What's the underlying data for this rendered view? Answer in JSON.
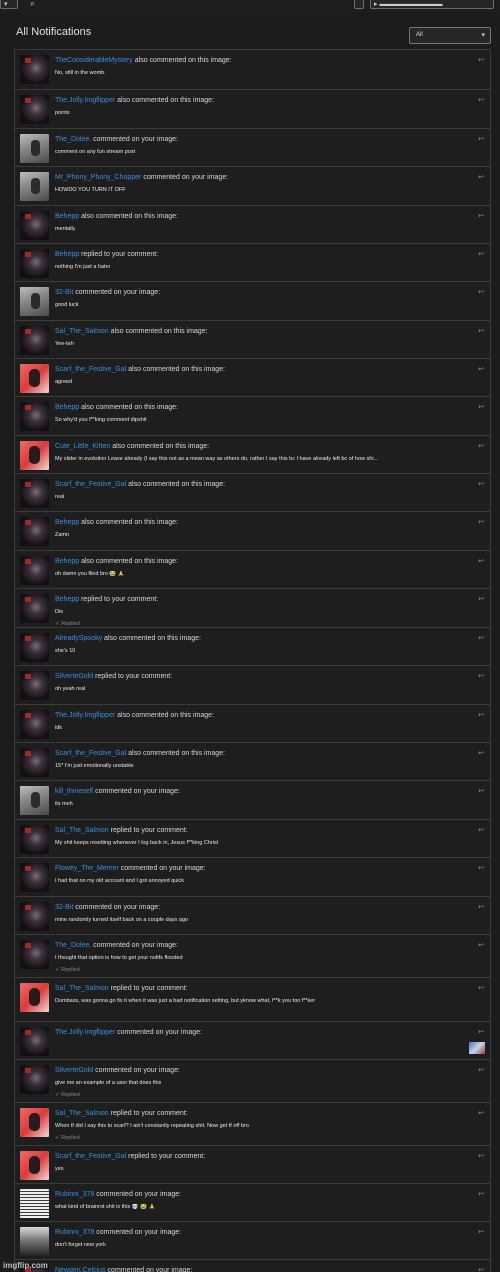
{
  "topbar": {
    "search_icon": "search-icon",
    "dropdown_icon": "chevron-down-icon"
  },
  "header": {
    "title": "All Notifications",
    "filter": {
      "selected": "All"
    }
  },
  "notifications": [
    {
      "user": "TheConsiderableMystery",
      "action": "also commented on this image:",
      "message": "No, still in the womb.",
      "avatar": "dark"
    },
    {
      "user": "The.Jolly.Imgflipper",
      "action": "also commented on this image:",
      "message": "points",
      "avatar": "dark"
    },
    {
      "user": "The_Dolee.",
      "action": "commented on your image:",
      "message": "comment on any fun stream post",
      "avatar": "gray"
    },
    {
      "user": "Mr_Phony_Phony_Chopper",
      "action": "commented on your image:",
      "message": "HOWDO YOU TURN IT OFF",
      "avatar": "gray"
    },
    {
      "user": "Behepp",
      "action": "also commented on this image:",
      "message": "mentally",
      "avatar": "dark"
    },
    {
      "user": "Behepp",
      "action": "replied to your comment:",
      "message": "nothing I'm just a hater",
      "avatar": "dark"
    },
    {
      "user": "32-Bit",
      "action": "commented on your image:",
      "message": "good luck",
      "avatar": "gray"
    },
    {
      "user": "Sal_The_Salmon",
      "action": "also commented on this image:",
      "message": "Yee-teh",
      "avatar": "dark"
    },
    {
      "user": "Scarf_the_Festive_Gal",
      "action": "also commented on this image:",
      "message": "agreed",
      "avatar": "red"
    },
    {
      "user": "Behepp",
      "action": "also commented on this image:",
      "message": "So why'd you f**king comment dipshit",
      "avatar": "dark"
    },
    {
      "user": "Cute_Little_Kitten",
      "action": "also commented on this image:",
      "message": "My slider in evolution Leave already (I say this not as a mean way as others do, rather I say this bc I have already left bc of how shi...",
      "avatar": "red"
    },
    {
      "user": "Scarf_the_Festive_Gal",
      "action": "also commented on this image:",
      "message": "real",
      "avatar": "dark"
    },
    {
      "user": "Behepp",
      "action": "also commented on this image:",
      "message": "Zamn",
      "avatar": "dark"
    },
    {
      "user": "Behepp",
      "action": "also commented on this image:",
      "message": "oh damn you filed bro 😭 🙏",
      "avatar": "dark"
    },
    {
      "user": "Behepp",
      "action": "replied to your comment:",
      "message": "Die",
      "replied": "✓ Replied",
      "avatar": "dark"
    },
    {
      "user": "AlreadySpooky",
      "action": "also commented on this image:",
      "message": "she's 10",
      "avatar": "dark"
    },
    {
      "user": "SilverteGold",
      "action": "replied to your comment:",
      "message": "oh yeah real",
      "avatar": "dark"
    },
    {
      "user": "The.Jolly.Imgflipper",
      "action": "also commented on this image:",
      "message": "idk",
      "avatar": "dark"
    },
    {
      "user": "Scarf_the_Festive_Gal",
      "action": "also commented on this image:",
      "message": "15* I'm just emotionally unstable",
      "avatar": "dark"
    },
    {
      "user": "kill_thineself",
      "action": "commented on your image:",
      "message": "its meh",
      "avatar": "gray"
    },
    {
      "user": "Sal_The_Salmon",
      "action": "replied to your comment:",
      "message": "My shit keeps resetting whenever I log back in, Jesus f**king Christ",
      "avatar": "dark"
    },
    {
      "user": "Flowey_The_Memer",
      "action": "commented on your image:",
      "message": "I had that on my old account and I got annoyed quick",
      "avatar": "dark"
    },
    {
      "user": "32-Bit",
      "action": "commented on your image:",
      "message": "mine randomly turned itself back on a couple days ago",
      "avatar": "dark"
    },
    {
      "user": "The_Dolee.",
      "action": "commented on your image:",
      "message": "I thought that option is how to get your notifs flooded",
      "replied": "✓ Replied",
      "avatar": "dark"
    },
    {
      "user": "Sal_The_Salmon",
      "action": "replied to your comment:",
      "message": "Dumbass, was gonna go fix it when it was just a bad notification setting, but yknow what, f**k you too f**ker",
      "avatar": "red"
    },
    {
      "user": "The.Jolly.Imgflipper",
      "action": "commented on your image:",
      "message": "",
      "thumb": true,
      "avatar": "dark"
    },
    {
      "user": "SilverteGold",
      "action": "commented on your image:",
      "message": "give me an example of a user that does this",
      "replied": "✓ Replied",
      "avatar": "dark"
    },
    {
      "user": "Sal_The_Salmon",
      "action": "replied to your comment:",
      "message": "When tf did I say this to scarf? I ain't constantly repeating shit. Now get tf off bro",
      "replied": "✓ Replied",
      "avatar": "red"
    },
    {
      "user": "Scarf_the_Festive_Gal",
      "action": "replied to your comment:",
      "message": "yes",
      "avatar": "red"
    },
    {
      "user": "Rubinni_378",
      "action": "commented on your image:",
      "message": "what kind of brainrot shit is this 💀 😭 🙏",
      "avatar": "paper"
    },
    {
      "user": "Rubinni_378",
      "action": "commented on your image:",
      "message": "don't forget new york",
      "avatar": "photo"
    },
    {
      "user": "Newgen.Celcius",
      "action": "commented on your image:",
      "message": "",
      "avatar": "dark"
    }
  ],
  "watermark": "imgflip.com"
}
